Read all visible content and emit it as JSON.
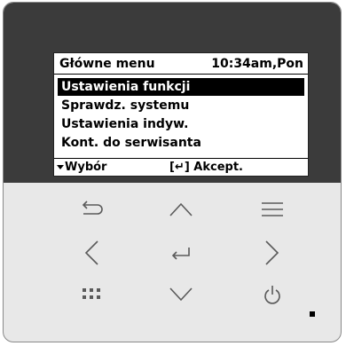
{
  "screen": {
    "title": "Główne menu",
    "clock": "10:34am,Pon",
    "menu_items": [
      {
        "label": "Ustawienia funkcji",
        "selected": true
      },
      {
        "label": "Sprawdz. systemu",
        "selected": false
      },
      {
        "label": "Ustawienia indyw.",
        "selected": false
      },
      {
        "label": "Kont. do serwisanta",
        "selected": false
      }
    ],
    "footer": {
      "left_label": "Wybór",
      "right_label": "[↵] Akcept."
    }
  },
  "buttons": [
    {
      "name": "back-button",
      "icon": "back-arrow-icon"
    },
    {
      "name": "up-button",
      "icon": "chevron-up-icon"
    },
    {
      "name": "menu-button",
      "icon": "hamburger-icon"
    },
    {
      "name": "left-button",
      "icon": "chevron-left-icon"
    },
    {
      "name": "enter-button",
      "icon": "enter-icon"
    },
    {
      "name": "right-button",
      "icon": "chevron-right-icon"
    },
    {
      "name": "grid-button",
      "icon": "grid-icon"
    },
    {
      "name": "down-button",
      "icon": "chevron-down-icon"
    },
    {
      "name": "power-button",
      "icon": "power-icon"
    }
  ],
  "colors": {
    "panel_dark": "#3b3b3b",
    "panel_light": "#e8e8e8",
    "icon": "#5a5a5a",
    "selected_bg": "#000000"
  }
}
